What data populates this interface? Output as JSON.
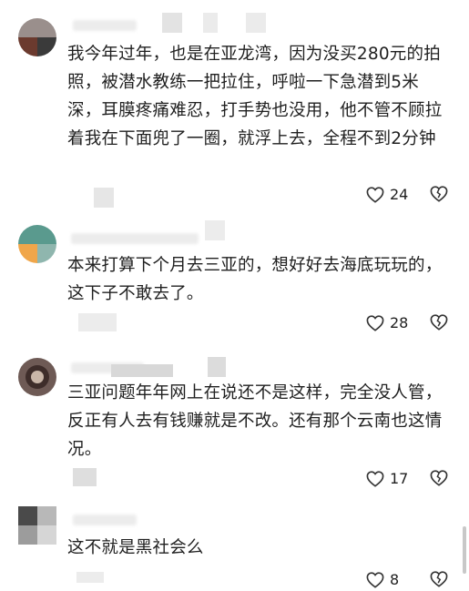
{
  "comments": [
    {
      "text": "我今年过年，也是在亚龙湾，因为没买280元的拍照，被潜水教练一把拉住，呼啦一下急潜到5米深，耳膜疼痛难忍，打手势也没用，他不管不顾拉着我在下面兜了一圈，就浮上去，全程不到2分钟",
      "likes": "24"
    },
    {
      "text": "本来打算下个月去三亚的，想好好去海底玩玩的，这下子不敢去了。",
      "likes": "28"
    },
    {
      "text": "三亚问题年年网上在说还不是这样，完全没人管，反正有人去有钱赚就是不改。还有那个云南也这情况。",
      "likes": "17"
    },
    {
      "text": "这不就是黑社会么",
      "likes": "8"
    }
  ],
  "icons": {
    "like": "heart-outline-icon",
    "dislike": "broken-heart-icon"
  }
}
